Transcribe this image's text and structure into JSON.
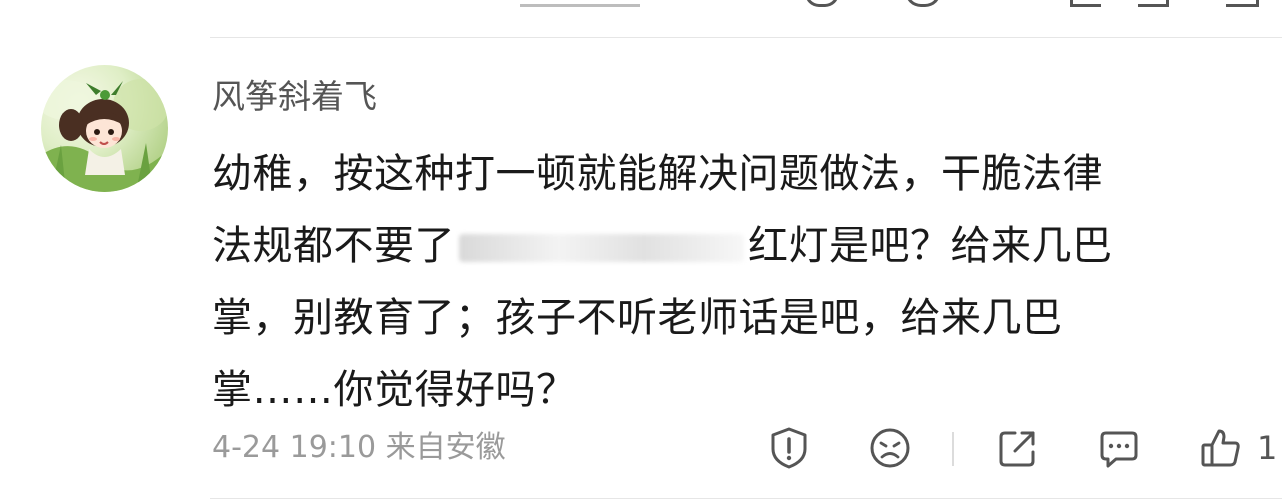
{
  "comment": {
    "username": "风筝斜着飞",
    "text_lines": [
      "幼稚，按这种打一顿就能解决问题做法，干脆法律",
      "法规都不要了",
      "红灯是吧？给来几巴",
      "掌，别教育了；孩子不听老师话是吧，给来几巴",
      "掌……你觉得好吗？"
    ],
    "timestamp": "4-24 19:10",
    "location": "来自安徽",
    "like_count": "1"
  },
  "icons": {
    "report": "report-icon",
    "dislike": "dislike-icon",
    "share": "share-icon",
    "reply": "reply-icon",
    "like": "like-icon"
  },
  "colors": {
    "text": "#1a1a1a",
    "username": "#555555",
    "meta": "#9a9a9a",
    "icon": "#555555",
    "divider": "#e6e6e6"
  }
}
